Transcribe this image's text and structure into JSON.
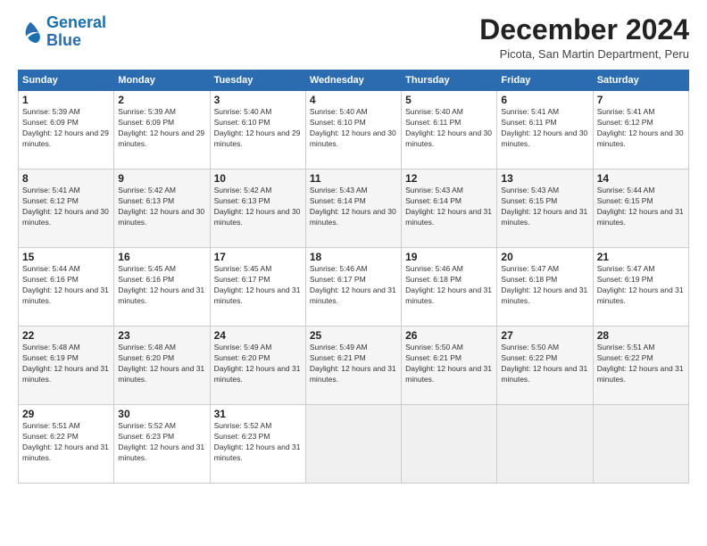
{
  "logo": {
    "line1": "General",
    "line2": "Blue"
  },
  "title": "December 2024",
  "location": "Picota, San Martin Department, Peru",
  "days_header": [
    "Sunday",
    "Monday",
    "Tuesday",
    "Wednesday",
    "Thursday",
    "Friday",
    "Saturday"
  ],
  "weeks": [
    [
      {
        "num": "1",
        "sunrise": "5:39 AM",
        "sunset": "6:09 PM",
        "daylight": "12 hours and 29 minutes."
      },
      {
        "num": "2",
        "sunrise": "5:39 AM",
        "sunset": "6:09 PM",
        "daylight": "12 hours and 29 minutes."
      },
      {
        "num": "3",
        "sunrise": "5:40 AM",
        "sunset": "6:10 PM",
        "daylight": "12 hours and 29 minutes."
      },
      {
        "num": "4",
        "sunrise": "5:40 AM",
        "sunset": "6:10 PM",
        "daylight": "12 hours and 30 minutes."
      },
      {
        "num": "5",
        "sunrise": "5:40 AM",
        "sunset": "6:11 PM",
        "daylight": "12 hours and 30 minutes."
      },
      {
        "num": "6",
        "sunrise": "5:41 AM",
        "sunset": "6:11 PM",
        "daylight": "12 hours and 30 minutes."
      },
      {
        "num": "7",
        "sunrise": "5:41 AM",
        "sunset": "6:12 PM",
        "daylight": "12 hours and 30 minutes."
      }
    ],
    [
      {
        "num": "8",
        "sunrise": "5:41 AM",
        "sunset": "6:12 PM",
        "daylight": "12 hours and 30 minutes."
      },
      {
        "num": "9",
        "sunrise": "5:42 AM",
        "sunset": "6:13 PM",
        "daylight": "12 hours and 30 minutes."
      },
      {
        "num": "10",
        "sunrise": "5:42 AM",
        "sunset": "6:13 PM",
        "daylight": "12 hours and 30 minutes."
      },
      {
        "num": "11",
        "sunrise": "5:43 AM",
        "sunset": "6:14 PM",
        "daylight": "12 hours and 30 minutes."
      },
      {
        "num": "12",
        "sunrise": "5:43 AM",
        "sunset": "6:14 PM",
        "daylight": "12 hours and 31 minutes."
      },
      {
        "num": "13",
        "sunrise": "5:43 AM",
        "sunset": "6:15 PM",
        "daylight": "12 hours and 31 minutes."
      },
      {
        "num": "14",
        "sunrise": "5:44 AM",
        "sunset": "6:15 PM",
        "daylight": "12 hours and 31 minutes."
      }
    ],
    [
      {
        "num": "15",
        "sunrise": "5:44 AM",
        "sunset": "6:16 PM",
        "daylight": "12 hours and 31 minutes."
      },
      {
        "num": "16",
        "sunrise": "5:45 AM",
        "sunset": "6:16 PM",
        "daylight": "12 hours and 31 minutes."
      },
      {
        "num": "17",
        "sunrise": "5:45 AM",
        "sunset": "6:17 PM",
        "daylight": "12 hours and 31 minutes."
      },
      {
        "num": "18",
        "sunrise": "5:46 AM",
        "sunset": "6:17 PM",
        "daylight": "12 hours and 31 minutes."
      },
      {
        "num": "19",
        "sunrise": "5:46 AM",
        "sunset": "6:18 PM",
        "daylight": "12 hours and 31 minutes."
      },
      {
        "num": "20",
        "sunrise": "5:47 AM",
        "sunset": "6:18 PM",
        "daylight": "12 hours and 31 minutes."
      },
      {
        "num": "21",
        "sunrise": "5:47 AM",
        "sunset": "6:19 PM",
        "daylight": "12 hours and 31 minutes."
      }
    ],
    [
      {
        "num": "22",
        "sunrise": "5:48 AM",
        "sunset": "6:19 PM",
        "daylight": "12 hours and 31 minutes."
      },
      {
        "num": "23",
        "sunrise": "5:48 AM",
        "sunset": "6:20 PM",
        "daylight": "12 hours and 31 minutes."
      },
      {
        "num": "24",
        "sunrise": "5:49 AM",
        "sunset": "6:20 PM",
        "daylight": "12 hours and 31 minutes."
      },
      {
        "num": "25",
        "sunrise": "5:49 AM",
        "sunset": "6:21 PM",
        "daylight": "12 hours and 31 minutes."
      },
      {
        "num": "26",
        "sunrise": "5:50 AM",
        "sunset": "6:21 PM",
        "daylight": "12 hours and 31 minutes."
      },
      {
        "num": "27",
        "sunrise": "5:50 AM",
        "sunset": "6:22 PM",
        "daylight": "12 hours and 31 minutes."
      },
      {
        "num": "28",
        "sunrise": "5:51 AM",
        "sunset": "6:22 PM",
        "daylight": "12 hours and 31 minutes."
      }
    ],
    [
      {
        "num": "29",
        "sunrise": "5:51 AM",
        "sunset": "6:22 PM",
        "daylight": "12 hours and 31 minutes."
      },
      {
        "num": "30",
        "sunrise": "5:52 AM",
        "sunset": "6:23 PM",
        "daylight": "12 hours and 31 minutes."
      },
      {
        "num": "31",
        "sunrise": "5:52 AM",
        "sunset": "6:23 PM",
        "daylight": "12 hours and 31 minutes."
      },
      null,
      null,
      null,
      null
    ]
  ]
}
